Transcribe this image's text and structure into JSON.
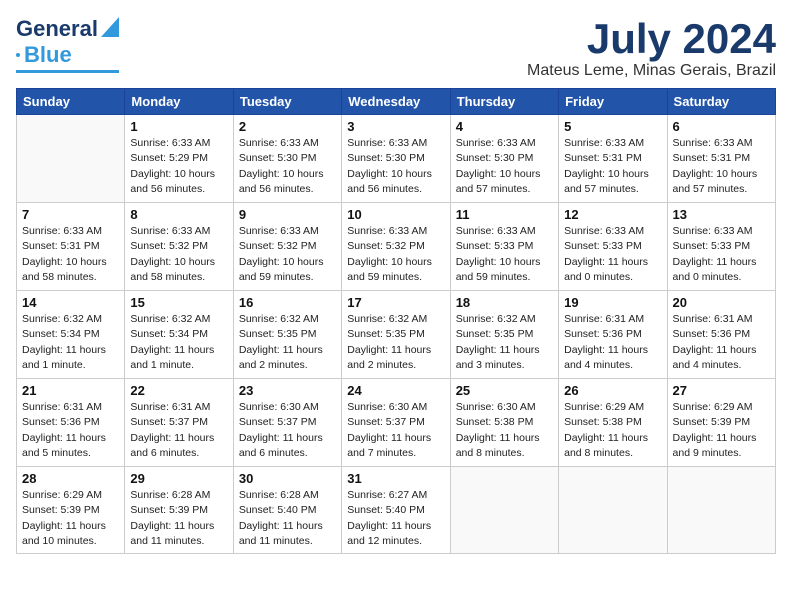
{
  "logo": {
    "line1": "General",
    "line2": "Blue"
  },
  "title": "July 2024",
  "location": "Mateus Leme, Minas Gerais, Brazil",
  "headers": [
    "Sunday",
    "Monday",
    "Tuesday",
    "Wednesday",
    "Thursday",
    "Friday",
    "Saturday"
  ],
  "weeks": [
    [
      {
        "day": "",
        "info": ""
      },
      {
        "day": "1",
        "info": "Sunrise: 6:33 AM\nSunset: 5:29 PM\nDaylight: 10 hours\nand 56 minutes."
      },
      {
        "day": "2",
        "info": "Sunrise: 6:33 AM\nSunset: 5:30 PM\nDaylight: 10 hours\nand 56 minutes."
      },
      {
        "day": "3",
        "info": "Sunrise: 6:33 AM\nSunset: 5:30 PM\nDaylight: 10 hours\nand 56 minutes."
      },
      {
        "day": "4",
        "info": "Sunrise: 6:33 AM\nSunset: 5:30 PM\nDaylight: 10 hours\nand 57 minutes."
      },
      {
        "day": "5",
        "info": "Sunrise: 6:33 AM\nSunset: 5:31 PM\nDaylight: 10 hours\nand 57 minutes."
      },
      {
        "day": "6",
        "info": "Sunrise: 6:33 AM\nSunset: 5:31 PM\nDaylight: 10 hours\nand 57 minutes."
      }
    ],
    [
      {
        "day": "7",
        "info": "Sunrise: 6:33 AM\nSunset: 5:31 PM\nDaylight: 10 hours\nand 58 minutes."
      },
      {
        "day": "8",
        "info": "Sunrise: 6:33 AM\nSunset: 5:32 PM\nDaylight: 10 hours\nand 58 minutes."
      },
      {
        "day": "9",
        "info": "Sunrise: 6:33 AM\nSunset: 5:32 PM\nDaylight: 10 hours\nand 59 minutes."
      },
      {
        "day": "10",
        "info": "Sunrise: 6:33 AM\nSunset: 5:32 PM\nDaylight: 10 hours\nand 59 minutes."
      },
      {
        "day": "11",
        "info": "Sunrise: 6:33 AM\nSunset: 5:33 PM\nDaylight: 10 hours\nand 59 minutes."
      },
      {
        "day": "12",
        "info": "Sunrise: 6:33 AM\nSunset: 5:33 PM\nDaylight: 11 hours\nand 0 minutes."
      },
      {
        "day": "13",
        "info": "Sunrise: 6:33 AM\nSunset: 5:33 PM\nDaylight: 11 hours\nand 0 minutes."
      }
    ],
    [
      {
        "day": "14",
        "info": "Sunrise: 6:32 AM\nSunset: 5:34 PM\nDaylight: 11 hours\nand 1 minute."
      },
      {
        "day": "15",
        "info": "Sunrise: 6:32 AM\nSunset: 5:34 PM\nDaylight: 11 hours\nand 1 minute."
      },
      {
        "day": "16",
        "info": "Sunrise: 6:32 AM\nSunset: 5:35 PM\nDaylight: 11 hours\nand 2 minutes."
      },
      {
        "day": "17",
        "info": "Sunrise: 6:32 AM\nSunset: 5:35 PM\nDaylight: 11 hours\nand 2 minutes."
      },
      {
        "day": "18",
        "info": "Sunrise: 6:32 AM\nSunset: 5:35 PM\nDaylight: 11 hours\nand 3 minutes."
      },
      {
        "day": "19",
        "info": "Sunrise: 6:31 AM\nSunset: 5:36 PM\nDaylight: 11 hours\nand 4 minutes."
      },
      {
        "day": "20",
        "info": "Sunrise: 6:31 AM\nSunset: 5:36 PM\nDaylight: 11 hours\nand 4 minutes."
      }
    ],
    [
      {
        "day": "21",
        "info": "Sunrise: 6:31 AM\nSunset: 5:36 PM\nDaylight: 11 hours\nand 5 minutes."
      },
      {
        "day": "22",
        "info": "Sunrise: 6:31 AM\nSunset: 5:37 PM\nDaylight: 11 hours\nand 6 minutes."
      },
      {
        "day": "23",
        "info": "Sunrise: 6:30 AM\nSunset: 5:37 PM\nDaylight: 11 hours\nand 6 minutes."
      },
      {
        "day": "24",
        "info": "Sunrise: 6:30 AM\nSunset: 5:37 PM\nDaylight: 11 hours\nand 7 minutes."
      },
      {
        "day": "25",
        "info": "Sunrise: 6:30 AM\nSunset: 5:38 PM\nDaylight: 11 hours\nand 8 minutes."
      },
      {
        "day": "26",
        "info": "Sunrise: 6:29 AM\nSunset: 5:38 PM\nDaylight: 11 hours\nand 8 minutes."
      },
      {
        "day": "27",
        "info": "Sunrise: 6:29 AM\nSunset: 5:39 PM\nDaylight: 11 hours\nand 9 minutes."
      }
    ],
    [
      {
        "day": "28",
        "info": "Sunrise: 6:29 AM\nSunset: 5:39 PM\nDaylight: 11 hours\nand 10 minutes."
      },
      {
        "day": "29",
        "info": "Sunrise: 6:28 AM\nSunset: 5:39 PM\nDaylight: 11 hours\nand 11 minutes."
      },
      {
        "day": "30",
        "info": "Sunrise: 6:28 AM\nSunset: 5:40 PM\nDaylight: 11 hours\nand 11 minutes."
      },
      {
        "day": "31",
        "info": "Sunrise: 6:27 AM\nSunset: 5:40 PM\nDaylight: 11 hours\nand 12 minutes."
      },
      {
        "day": "",
        "info": ""
      },
      {
        "day": "",
        "info": ""
      },
      {
        "day": "",
        "info": ""
      }
    ]
  ]
}
